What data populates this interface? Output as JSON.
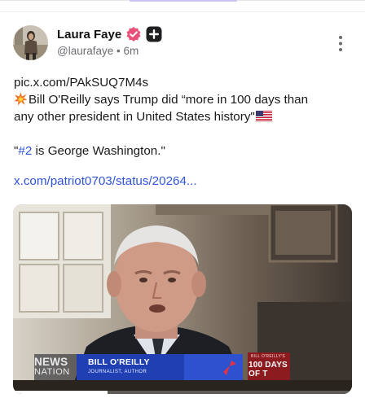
{
  "author": {
    "name": "Laura Faye",
    "handle": "@laurafaye",
    "separator": "•",
    "time": "6m",
    "verified_color": "#e8527a",
    "plus_badge_color": "#1f1f22"
  },
  "post": {
    "line1": "pic.x.com/PAkSUQ7M4s",
    "line2": "Bill O'Reilly says Trump did “more in 100 days than",
    "line3": "any other president in United States history\"",
    "quote_open": "\"",
    "hashtag": "#2",
    "quote_rest": " is George Washington.\"",
    "link": "x.com/patriot0703/status/20264...",
    "accent_color": "#2f54d8",
    "icons": [
      "collision-emoji-icon",
      "us-flag-emoji-icon"
    ]
  },
  "media": {
    "network_top": "NEWS",
    "network_bottom": "NATION",
    "lower_third_name": "BILL O'REILLY",
    "lower_third_title": "JOURNALIST, AUTHOR",
    "promo_small": "BILL O'REILLY'S",
    "promo_big_1": "100 DAYS",
    "promo_big_2": "OF T",
    "progress": 0.28
  },
  "menu": {
    "icon": "more-vertical-icon"
  }
}
